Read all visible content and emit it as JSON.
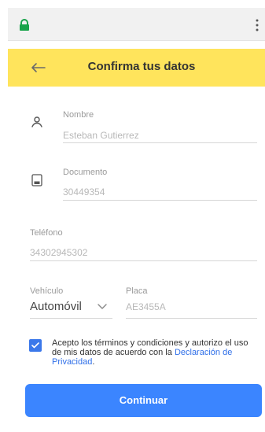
{
  "app": {
    "title": "Confirma tus datos"
  },
  "browser": {
    "lock_icon": "lock-icon",
    "menu_icon": "menu-icon"
  },
  "form": {
    "name": {
      "label": "Nombre",
      "value": "Esteban Gutierrez"
    },
    "document": {
      "label": "Documento",
      "value": "30449354"
    },
    "phone": {
      "label": "Teléfono",
      "value": "34302945302"
    },
    "vehicle": {
      "label": "Vehículo",
      "value": "Automóvil"
    },
    "plate": {
      "label": "Placa",
      "value": "AE3455A"
    },
    "terms": {
      "text_before": "Acepto los términos y condiciones y autorizo el uso de mis datos de acuerdo con la ",
      "link": "Declaración de Privacidad",
      "text_after": ".",
      "checked": true
    }
  },
  "actions": {
    "continue_label": "Continuar"
  },
  "colors": {
    "header_bg": "#ffe45c",
    "primary": "#3b85ff",
    "link": "#2f6fe8",
    "checkbox": "#3b78ea"
  }
}
